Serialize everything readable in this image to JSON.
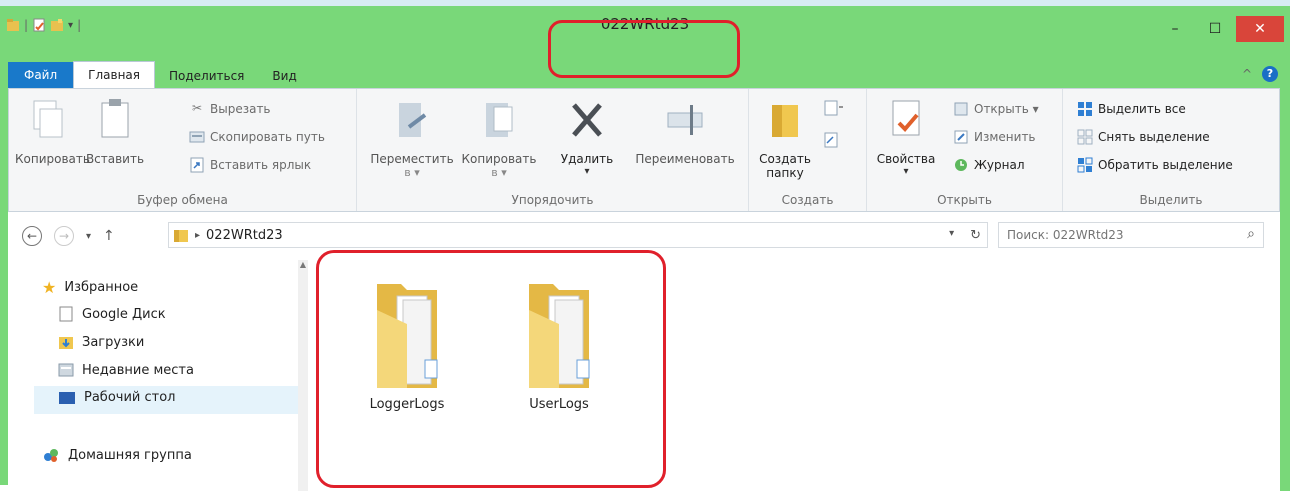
{
  "window": {
    "title": "022WRtd23",
    "controls": {
      "minimize": "–",
      "maximize": "☐",
      "close": "✕"
    }
  },
  "tabs": [
    {
      "label": "Файл"
    },
    {
      "label": "Главная"
    },
    {
      "label": "Поделиться"
    },
    {
      "label": "Вид"
    }
  ],
  "ribbon": {
    "clipboard": {
      "label": "Буфер обмена",
      "copy": "Копировать",
      "paste": "Вставить",
      "cut": "Вырезать",
      "copy_path": "Скопировать путь",
      "paste_shortcut": "Вставить ярлык"
    },
    "organize": {
      "label": "Упорядочить",
      "move_to": "Переместить",
      "move_to_sub": "в ▾",
      "copy_to": "Копировать",
      "copy_to_sub": "в ▾",
      "delete": "Удалить",
      "rename": "Переименовать"
    },
    "create": {
      "label": "Создать",
      "new_folder_1": "Создать",
      "new_folder_2": "папку"
    },
    "open": {
      "label": "Открыть",
      "properties": "Свойства",
      "open": "Открыть ▾",
      "edit": "Изменить",
      "history": "Журнал"
    },
    "select": {
      "label": "Выделить",
      "select_all": "Выделить все",
      "select_none": "Снять выделение",
      "invert": "Обратить выделение"
    }
  },
  "address": {
    "path": "022WRtd23",
    "search_placeholder": "Поиск: 022WRtd23"
  },
  "nav": {
    "favorites": "Избранное",
    "items": [
      {
        "label": "Google Диск"
      },
      {
        "label": "Загрузки"
      },
      {
        "label": "Недавние места"
      },
      {
        "label": "Рабочий стол"
      }
    ],
    "homegroup": "Домашняя группа"
  },
  "folders": [
    {
      "name": "LoggerLogs"
    },
    {
      "name": "UserLogs"
    }
  ],
  "colors": {
    "frame": "#79d879",
    "file_tab": "#1979ca",
    "close_button": "#d9453a",
    "highlight": "#e0202b",
    "selection": "#e5f3fb"
  }
}
